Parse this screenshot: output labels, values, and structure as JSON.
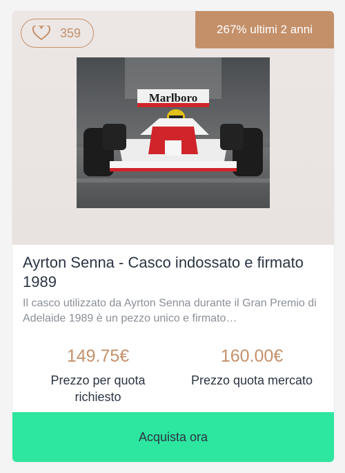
{
  "card": {
    "likes": "359",
    "growth_badge": "267% ultimi 2 anni",
    "title": "Ayrton Senna - Casco indossato e firmato 1989",
    "description": "Il casco utilizzato da Ayrton Senna durante il Gran Premio di Adelaide 1989 è un pezzo unico e firmato…",
    "image_sign_text": "Marlboro",
    "prices": [
      {
        "value": "149.75€",
        "label": "Prezzo per quota richiesto"
      },
      {
        "value": "160.00€",
        "label": "Prezzo quota mercato"
      }
    ],
    "buy_label": "Acquista ora"
  },
  "icons": {
    "like": "heart-outline-icon"
  },
  "colors": {
    "accent": "#c4906a",
    "button": "#2de6a0",
    "title_text": "#2b3442",
    "description_text": "#8a8f96"
  }
}
